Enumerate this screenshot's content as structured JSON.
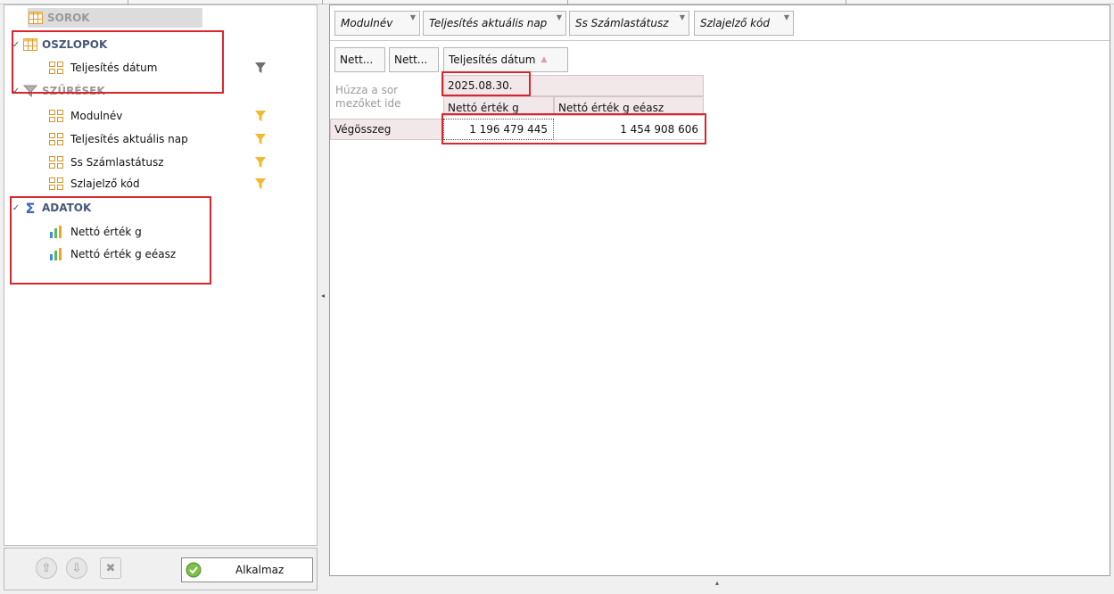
{
  "left_panel": {
    "sections": {
      "sorok": {
        "label": "SOROK",
        "icon": "table-icon"
      },
      "oszlopok": {
        "label": "OSZLOPOK",
        "icon": "table-icon",
        "items": [
          {
            "label": "Teljesítés dátum",
            "icon": "field-grid-icon",
            "filter_icon": "filter-gray-icon"
          }
        ]
      },
      "szuresek": {
        "label": "SZŰRÉSEK",
        "icon": "filter-icon",
        "items": [
          {
            "label": "Modulnév",
            "icon": "field-grid-icon",
            "filter_icon": "filter-yellow-icon"
          },
          {
            "label": "Teljesítés aktuális nap",
            "icon": "field-grid-icon",
            "filter_icon": "filter-yellow-icon"
          },
          {
            "label": "Ss Számlastátusz",
            "icon": "field-grid-icon",
            "filter_icon": "filter-yellow-icon"
          },
          {
            "label": "Szlajelző kód",
            "icon": "field-grid-icon",
            "filter_icon": "filter-yellow-icon"
          }
        ]
      },
      "adatok": {
        "label": "ADATOK",
        "icon": "sigma-icon",
        "items": [
          {
            "label": "Nettó érték g",
            "icon": "bar-chart-icon"
          },
          {
            "label": "Nettó érték g eéasz",
            "icon": "bar-chart-icon"
          }
        ]
      }
    },
    "buttons": {
      "apply": "Alkalmaz",
      "move_up": "arrow-up-icon",
      "move_down": "arrow-down-icon",
      "remove": "remove-icon"
    }
  },
  "pivot": {
    "filter_fields": [
      "Modulnév",
      "Teljesítés aktuális nap",
      "Ss Számlastátusz",
      "Szlajelző kód"
    ],
    "data_field_buttons": [
      "Nett...",
      "Nett..."
    ],
    "column_field": "Teljesítés dátum",
    "row_drop_hint": [
      "Húzza a sor",
      "mezőket ide"
    ],
    "column_value": "2025.08.30.",
    "data_headers": [
      "Nettó érték g",
      "Nettó érték g eéasz"
    ],
    "row_label": "Végösszeg",
    "values": [
      "1 196 479 445",
      "1 454 908 606"
    ]
  },
  "colors": {
    "highlight": "#d9262c",
    "header_bg": "#f2e8e9",
    "section_label": "#46577a",
    "filter_yellow": "#f2b930"
  }
}
